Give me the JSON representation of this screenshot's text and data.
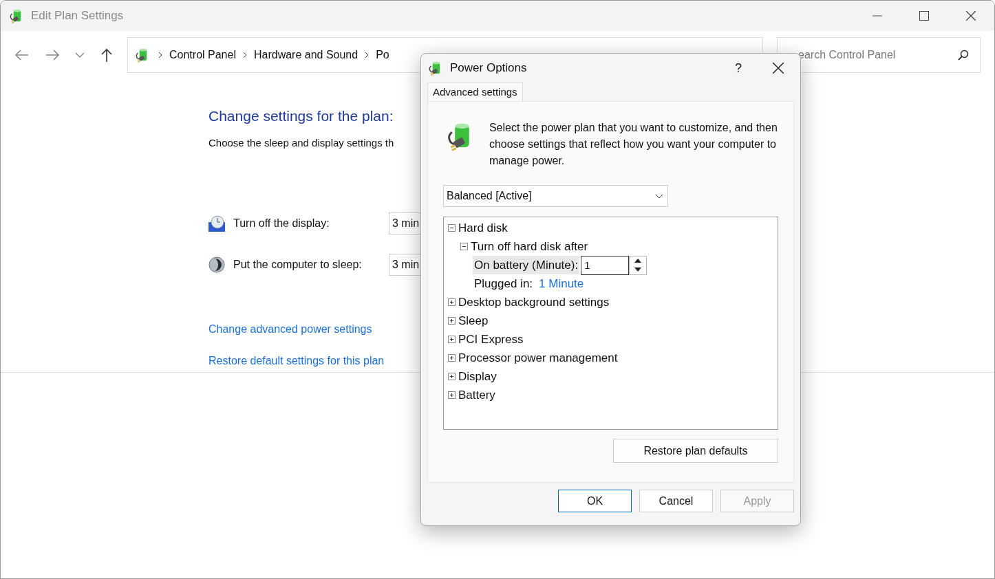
{
  "window": {
    "title": "Edit Plan Settings"
  },
  "breadcrumb": [
    "Control Panel",
    "Hardware and Sound",
    "Po"
  ],
  "search": {
    "placeholder": "earch Control Panel"
  },
  "content": {
    "heading": "Change settings for the plan:",
    "description": "Choose the sleep and display settings th",
    "settings": [
      {
        "kind": "display",
        "label": "Turn off the display:",
        "value": "3 min"
      },
      {
        "kind": "sleep",
        "label": "Put the computer to sleep:",
        "value": "3 min"
      }
    ],
    "links": [
      "Change advanced power settings",
      "Restore default settings for this plan"
    ]
  },
  "dialog": {
    "title": "Power Options",
    "help": "?",
    "tab": {
      "label": "Advanced settings",
      "selected": true
    },
    "intro": "Select the power plan that you want to customize, and then choose settings that reflect how you want your computer to manage power.",
    "plan": "Balanced [Active]",
    "tree": [
      {
        "kind": "group",
        "label": "Hard disk",
        "expanded": true,
        "children": [
          {
            "kind": "group",
            "label": "Turn off hard disk after",
            "expanded": true,
            "children": [
              {
                "kind": "spin",
                "label": "On battery (Minute):",
                "value": "1",
                "selected": true
              },
              {
                "kind": "value",
                "label": "Plugged in:",
                "value": "1 Minute",
                "selected": false
              }
            ]
          }
        ]
      },
      {
        "kind": "group",
        "label": "Desktop background settings",
        "expanded": false
      },
      {
        "kind": "group",
        "label": "Sleep",
        "expanded": false
      },
      {
        "kind": "group",
        "label": "PCI Express",
        "expanded": false
      },
      {
        "kind": "group",
        "label": "Processor power management",
        "expanded": false
      },
      {
        "kind": "group",
        "label": "Display",
        "expanded": false
      },
      {
        "kind": "group",
        "label": "Battery",
        "expanded": false
      }
    ],
    "restore_button": "Restore plan defaults",
    "buttons": [
      {
        "label": "OK",
        "disabled": false,
        "default": true
      },
      {
        "label": "Cancel",
        "disabled": false,
        "default": false
      },
      {
        "label": "Apply",
        "disabled": true,
        "default": false
      }
    ]
  }
}
